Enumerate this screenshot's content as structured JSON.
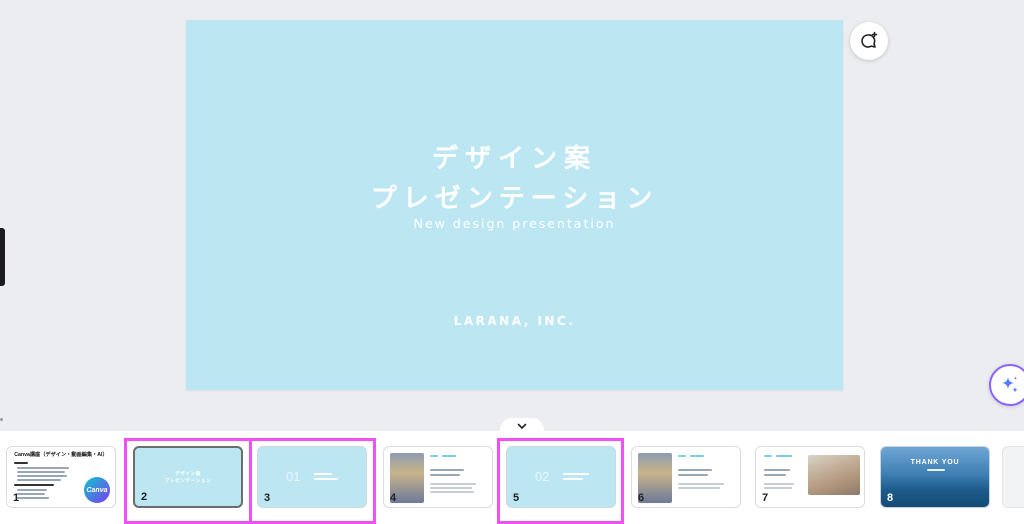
{
  "slide": {
    "title_line1": "デザイン案",
    "title_line2": "プレゼンテーション",
    "subtitle": "New design presentation",
    "company": "LARANA, INC."
  },
  "buttons": {
    "comment_icon": "comment-add-icon",
    "magic_icon": "sparkle-icon",
    "collapse_icon": "chevron-down-icon"
  },
  "thumbnails": [
    {
      "num": "1",
      "title": "Canva講座（デザイン・動画編集・AI）",
      "badge": "Canva"
    },
    {
      "num": "2",
      "line1": "デザイン案",
      "line2": "プレゼンテーション"
    },
    {
      "num": "3",
      "big": "01"
    },
    {
      "num": "4"
    },
    {
      "num": "5",
      "big": "02"
    },
    {
      "num": "6"
    },
    {
      "num": "7"
    },
    {
      "num": "8",
      "title": "THANK YOU"
    }
  ],
  "colors": {
    "slide_bg": "#bce7f2",
    "highlight": "#f050f5",
    "accent": "#8a63ff"
  }
}
